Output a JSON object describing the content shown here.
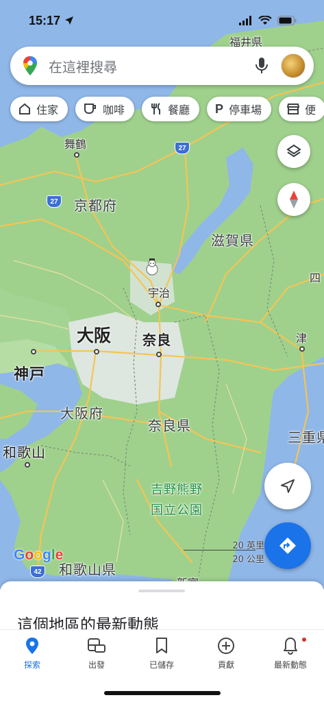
{
  "status_bar": {
    "time": "15:17"
  },
  "search": {
    "placeholder": "在這裡搜尋"
  },
  "chips": [
    {
      "label": "住家",
      "icon": "home-icon"
    },
    {
      "label": "咖啡",
      "icon": "coffee-icon"
    },
    {
      "label": "餐廳",
      "icon": "restaurant-icon"
    },
    {
      "label": "停車場",
      "icon": "parking-icon"
    },
    {
      "label": "便",
      "icon": "store-icon"
    }
  ],
  "map": {
    "labels": {
      "fukui": "福井県",
      "maizuru": "舞鶴",
      "kyoto_pref": "京都府",
      "shiga": "滋賀県",
      "uji": "宇治",
      "osaka": "大阪",
      "nara": "奈良",
      "kobe": "神戸",
      "tsu": "津",
      "shi": "四",
      "osaka_pref": "大阪府",
      "nara_pref": "奈良県",
      "mie": "三重県",
      "wakayama": "和歌山",
      "park_line1": "吉野熊野",
      "park_line2": "国立公園",
      "wakayama_pref": "和歌山県",
      "shingu": "新宮"
    },
    "routes": [
      "27",
      "27",
      "42"
    ],
    "google_logo": "Google"
  },
  "scale": {
    "miles": "20 英里",
    "km": "20 公里"
  },
  "sheet": {
    "title": "這個地區的最新動態"
  },
  "nav": [
    {
      "label": "探索",
      "icon": "explore-pin-icon",
      "active": true
    },
    {
      "label": "出發",
      "icon": "commute-icon",
      "active": false
    },
    {
      "label": "已儲存",
      "icon": "bookmark-icon",
      "active": false
    },
    {
      "label": "貢獻",
      "icon": "add-circle-icon",
      "active": false
    },
    {
      "label": "最新動態",
      "icon": "bell-icon",
      "active": false,
      "badge": true
    }
  ],
  "colors": {
    "accent": "#1a73e8",
    "water": "#8fb7e8",
    "land": "#9fd18d",
    "road": "#f6c453"
  }
}
